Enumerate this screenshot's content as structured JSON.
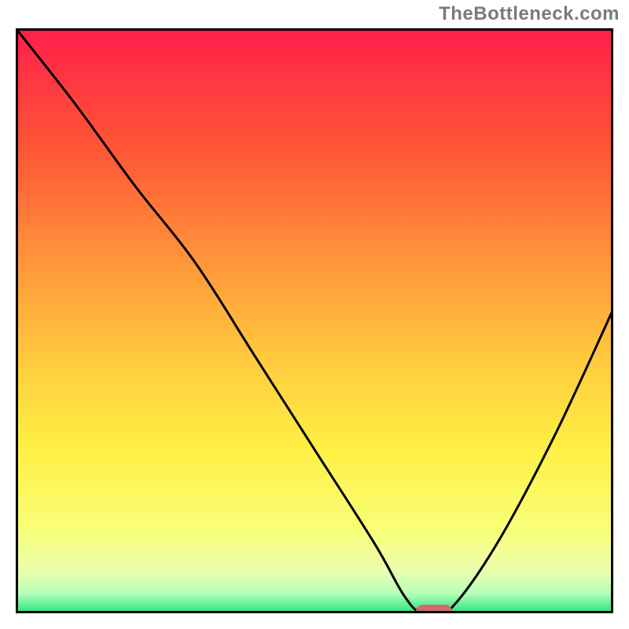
{
  "watermark": {
    "text": "TheBottleneck.com"
  },
  "chart_data": {
    "type": "line",
    "title": "",
    "xlabel": "",
    "ylabel": "",
    "xlim": [
      0,
      100
    ],
    "ylim": [
      0,
      100
    ],
    "grid": false,
    "series": [
      {
        "name": "curve",
        "x": [
          0,
          10,
          20,
          30,
          40,
          50,
          60,
          65,
          68,
          72,
          80,
          90,
          100
        ],
        "y": [
          100,
          87,
          73,
          60,
          44,
          28,
          12,
          3,
          0,
          0,
          11,
          30,
          52
        ]
      }
    ],
    "marker": {
      "x": 70,
      "y": 0,
      "color": "#d06a6d",
      "width": 6,
      "height": 2.4
    },
    "gradient_stops": [
      {
        "offset": 0.0,
        "color": "#ff1f4b"
      },
      {
        "offset": 0.2,
        "color": "#ff5436"
      },
      {
        "offset": 0.4,
        "color": "#ff963a"
      },
      {
        "offset": 0.58,
        "color": "#ffce3e"
      },
      {
        "offset": 0.72,
        "color": "#fef044"
      },
      {
        "offset": 0.86,
        "color": "#f9ff7a"
      },
      {
        "offset": 0.93,
        "color": "#e8ffb0"
      },
      {
        "offset": 0.965,
        "color": "#b8ffb8"
      },
      {
        "offset": 1.0,
        "color": "#25e57e"
      }
    ],
    "frame_color": "#000000",
    "curve_color": "#000000"
  }
}
